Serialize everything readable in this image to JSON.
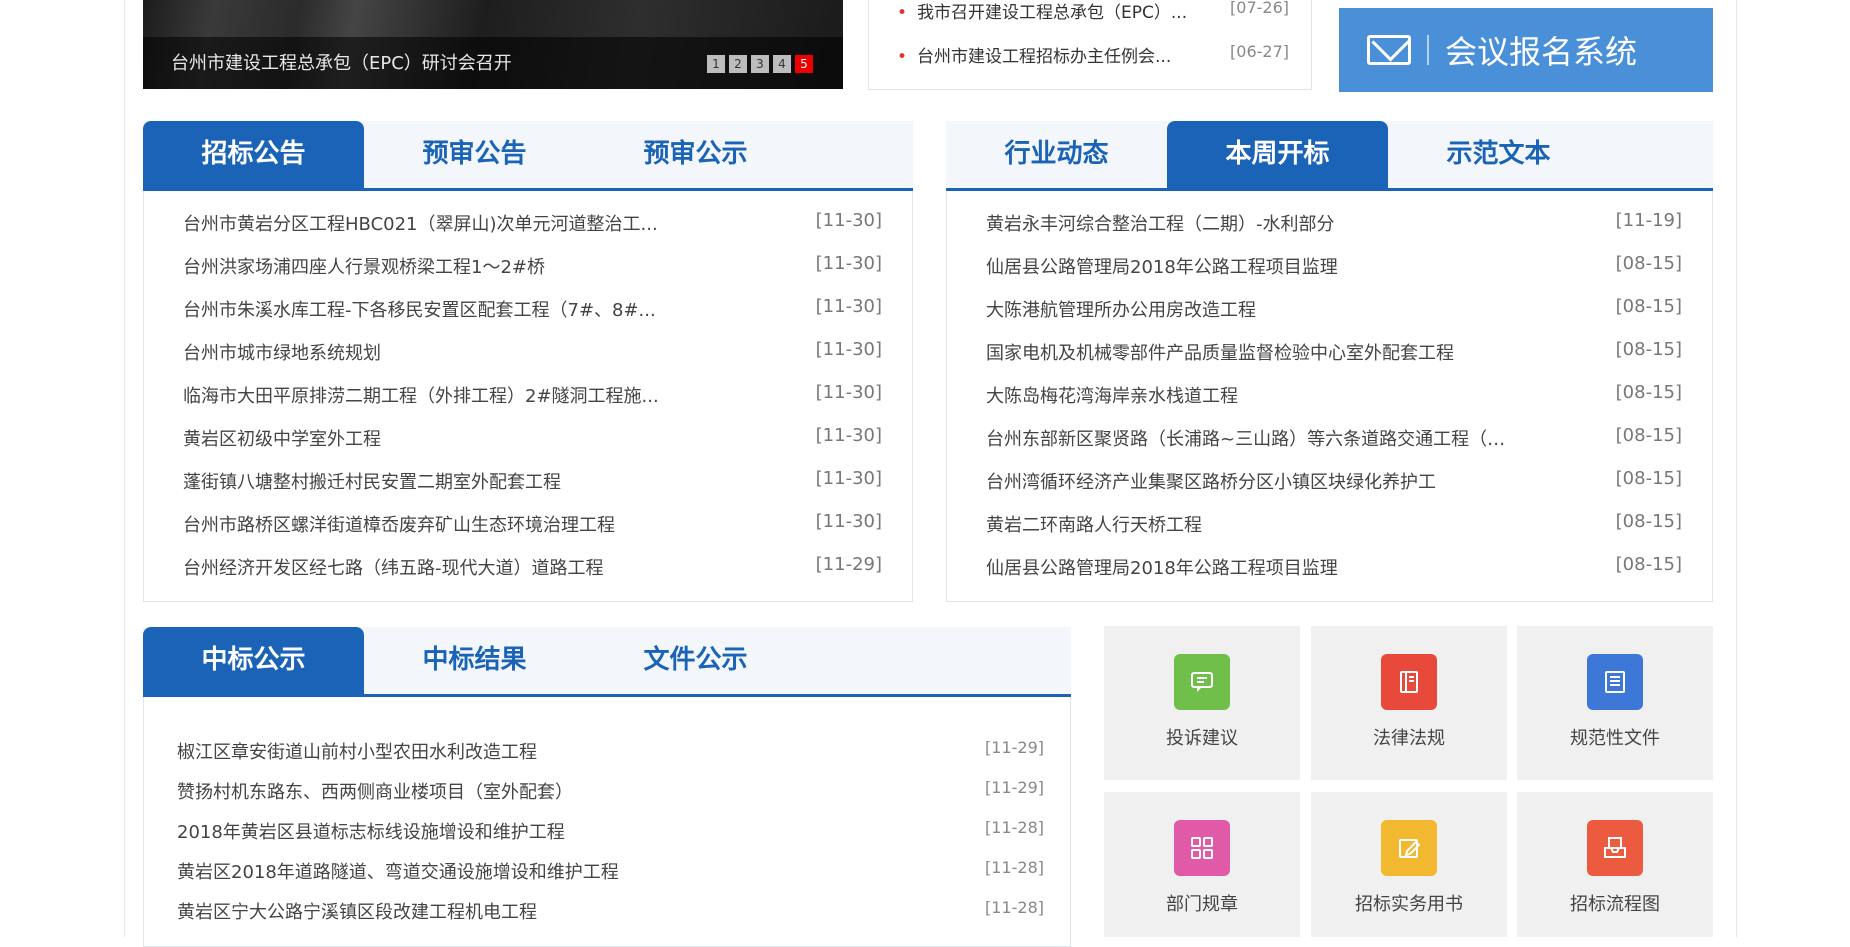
{
  "slideshow": {
    "caption": "台州市建设工程总承包（EPC）研讨会召开",
    "dots": [
      "1",
      "2",
      "3",
      "4",
      "5"
    ],
    "active_dot": "5"
  },
  "top_news": [
    {
      "title": "我市召开建设工程总承包（EPC）...",
      "date": "[07-26]"
    },
    {
      "title": "台州市建设工程招标办主任例会...",
      "date": "[06-27]"
    }
  ],
  "meeting": {
    "label": "会议报名系统"
  },
  "panel_left": {
    "tabs": [
      "招标公告",
      "预审公告",
      "预审公示"
    ],
    "active_tab": 0,
    "items": [
      {
        "title": "台州市黄岩分区工程HBC021（翠屏山)次单元河道整治工...",
        "date": "[11-30]"
      },
      {
        "title": "台州洪家场浦四座人行景观桥梁工程1～2#桥",
        "date": "[11-30]"
      },
      {
        "title": "台州市朱溪水库工程-下各移民安置区配套工程（7#、8#...",
        "date": "[11-30]"
      },
      {
        "title": "台州市城市绿地系统规划",
        "date": "[11-30]"
      },
      {
        "title": "临海市大田平原排涝二期工程（外排工程）2#隧洞工程施...",
        "date": "[11-30]"
      },
      {
        "title": "黄岩区初级中学室外工程",
        "date": "[11-30]"
      },
      {
        "title": "蓬街镇八塘整村搬迁村民安置二期室外配套工程",
        "date": "[11-30]"
      },
      {
        "title": "台州市路桥区螺洋街道樟岙废弃矿山生态环境治理工程",
        "date": "[11-30]"
      },
      {
        "title": "台州经济开发区经七路（纬五路-现代大道）道路工程",
        "date": "[11-29]"
      }
    ]
  },
  "panel_right": {
    "tabs": [
      "行业动态",
      "本周开标",
      "示范文本"
    ],
    "active_tab": 1,
    "items": [
      {
        "title": "黄岩永丰河综合整治工程（二期）-水利部分",
        "date": "[11-19]"
      },
      {
        "title": "仙居县公路管理局2018年公路工程项目监理",
        "date": "[08-15]"
      },
      {
        "title": "大陈港航管理所办公用房改造工程",
        "date": "[08-15]"
      },
      {
        "title": "国家电机及机械零部件产品质量监督检验中心室外配套工程",
        "date": "[08-15]"
      },
      {
        "title": "大陈岛梅花湾海岸亲水栈道工程",
        "date": "[08-15]"
      },
      {
        "title": "台州东部新区聚贤路（长浦路~三山路）等六条道路交通工程（标...",
        "date": "[08-15]"
      },
      {
        "title": "台州湾循环经济产业集聚区路桥分区小镇区块绿化养护工",
        "date": "[08-15]"
      },
      {
        "title": "黄岩二环南路人行天桥工程",
        "date": "[08-15]"
      },
      {
        "title": "仙居县公路管理局2018年公路工程项目监理",
        "date": "[08-15]"
      }
    ]
  },
  "panel_bottom": {
    "tabs": [
      "中标公示",
      "中标结果",
      "文件公示"
    ],
    "active_tab": 0,
    "items": [
      {
        "title": "椒江区章安街道山前村小型农田水利改造工程",
        "date": "[11-29]"
      },
      {
        "title": "赞扬村机东路东、西两侧商业楼项目（室外配套）",
        "date": "[11-29]"
      },
      {
        "title": "2018年黄岩区县道标志标线设施增设和维护工程",
        "date": "[11-28]"
      },
      {
        "title": "黄岩区2018年道路隧道、弯道交通设施增设和维护工程",
        "date": "[11-28]"
      },
      {
        "title": "黄岩区宁大公路宁溪镇区段改建工程机电工程",
        "date": "[11-28]"
      }
    ]
  },
  "quick_links": [
    {
      "label": "投诉建议",
      "icon": "complaint-icon",
      "color": "#6fbf4a"
    },
    {
      "label": "法律法规",
      "icon": "law-book-icon",
      "color": "#e8493a"
    },
    {
      "label": "规范性文件",
      "icon": "document-list-icon",
      "color": "#3d78d8"
    },
    {
      "label": "部门规章",
      "icon": "grid-apps-icon",
      "color": "#e05aa8"
    },
    {
      "label": "招标实务用书",
      "icon": "edit-book-icon",
      "color": "#f2b82f"
    },
    {
      "label": "招标流程图",
      "icon": "flowchart-tray-icon",
      "color": "#ec5a3f"
    }
  ]
}
